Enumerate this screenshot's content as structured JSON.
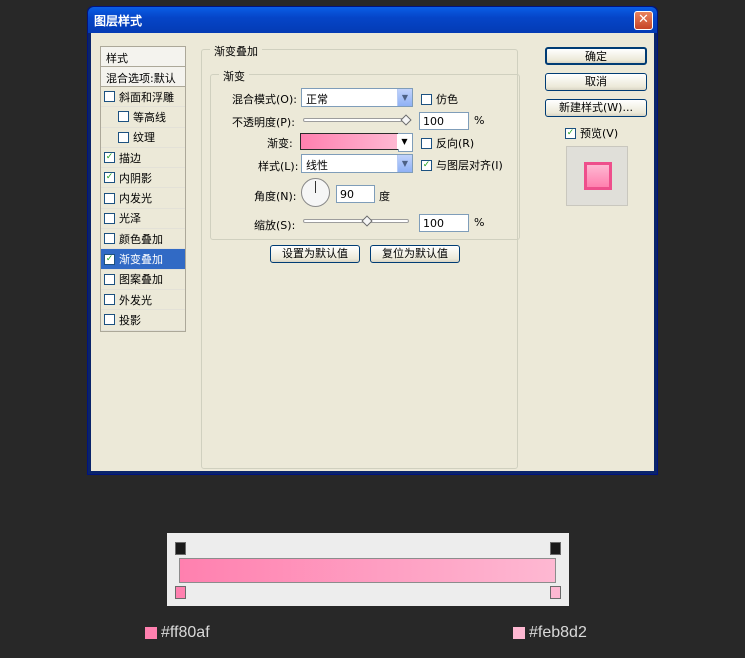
{
  "dialog": {
    "title": "图层样式",
    "close": "✕"
  },
  "left_list": {
    "header": "样式",
    "blend_options": "混合选项:默认",
    "items": [
      {
        "label": "斜面和浮雕",
        "checked": false,
        "indent": false
      },
      {
        "label": "等高线",
        "checked": false,
        "indent": true
      },
      {
        "label": "纹理",
        "checked": false,
        "indent": true
      },
      {
        "label": "描边",
        "checked": true,
        "indent": false
      },
      {
        "label": "内阴影",
        "checked": true,
        "indent": false
      },
      {
        "label": "内发光",
        "checked": false,
        "indent": false
      },
      {
        "label": "光泽",
        "checked": false,
        "indent": false
      },
      {
        "label": "颜色叠加",
        "checked": false,
        "indent": false
      },
      {
        "label": "渐变叠加",
        "checked": true,
        "indent": false,
        "selected": true
      },
      {
        "label": "图案叠加",
        "checked": false,
        "indent": false
      },
      {
        "label": "外发光",
        "checked": false,
        "indent": false
      },
      {
        "label": "投影",
        "checked": false,
        "indent": false
      }
    ]
  },
  "panel": {
    "group_title": "渐变叠加",
    "subgroup_title": "渐变",
    "blend_mode_label": "混合模式(O):",
    "blend_mode_value": "正常",
    "dither_label": "仿色",
    "opacity_label": "不透明度(P):",
    "opacity_value": "100",
    "percent": "%",
    "gradient_label": "渐变:",
    "reverse_label": "反向(R)",
    "style_label": "样式(L):",
    "style_value": "线性",
    "align_label": "与图层对齐(I)",
    "angle_label": "角度(N):",
    "angle_value": "90",
    "degree": "度",
    "scale_label": "缩放(S):",
    "scale_value": "100",
    "set_default": "设置为默认值",
    "reset_default": "复位为默认值"
  },
  "side_buttons": {
    "ok": "确定",
    "cancel": "取消",
    "new_style": "新建样式(W)...",
    "preview_label": "预览(V)"
  },
  "gradient": {
    "start_color": "#ff80af",
    "end_color": "#feb8d2",
    "start_label": "#ff80af",
    "end_label": "#feb8d2"
  },
  "check_glyph": "✓",
  "dropdown_glyph": "▼"
}
